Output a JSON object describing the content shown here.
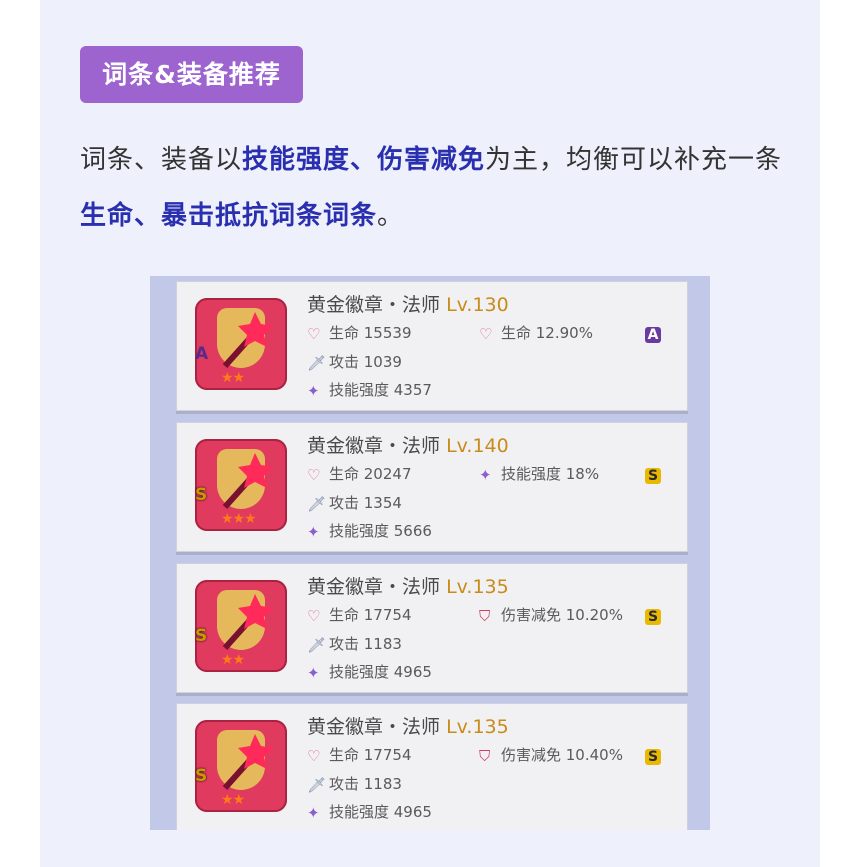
{
  "tag": {
    "label": "词条&装备推荐"
  },
  "paragraph": {
    "p1": "词条、装备以",
    "h1": "技能强度、伤害减免",
    "p2": "为主，均衡可以补充一条",
    "h2": "生命、暴击抵抗词条词条",
    "p3": "。"
  },
  "cards": [
    {
      "name": "黄金徽章・法师",
      "level": "Lv.130",
      "grade": "A",
      "stars": "★★",
      "hp": "生命 15539",
      "atk": "攻击 1039",
      "skill": "技能强度 4357",
      "sub_icon": "heart-icon",
      "sub": "生命 12.90%",
      "sub_grade": "A"
    },
    {
      "name": "黄金徽章・法师",
      "level": "Lv.140",
      "grade": "S",
      "stars": "★★★",
      "hp": "生命 20247",
      "atk": "攻击 1354",
      "skill": "技能强度 5666",
      "sub_icon": "wand-icon",
      "sub": "技能强度 18%",
      "sub_grade": "S"
    },
    {
      "name": "黄金徽章・法师",
      "level": "Lv.135",
      "grade": "S",
      "stars": "★★",
      "hp": "生命 17754",
      "atk": "攻击 1183",
      "skill": "技能强度 4965",
      "sub_icon": "damage-reduction-icon",
      "sub": "伤害减免 10.20%",
      "sub_grade": "S"
    },
    {
      "name": "黄金徽章・法师",
      "level": "Lv.135",
      "grade": "S",
      "stars": "★★",
      "hp": "生命 17754",
      "atk": "攻击 1183",
      "skill": "技能强度 4965",
      "sub_icon": "damage-reduction-icon",
      "sub": "伤害减免 10.40%",
      "sub_grade": "S"
    }
  ]
}
